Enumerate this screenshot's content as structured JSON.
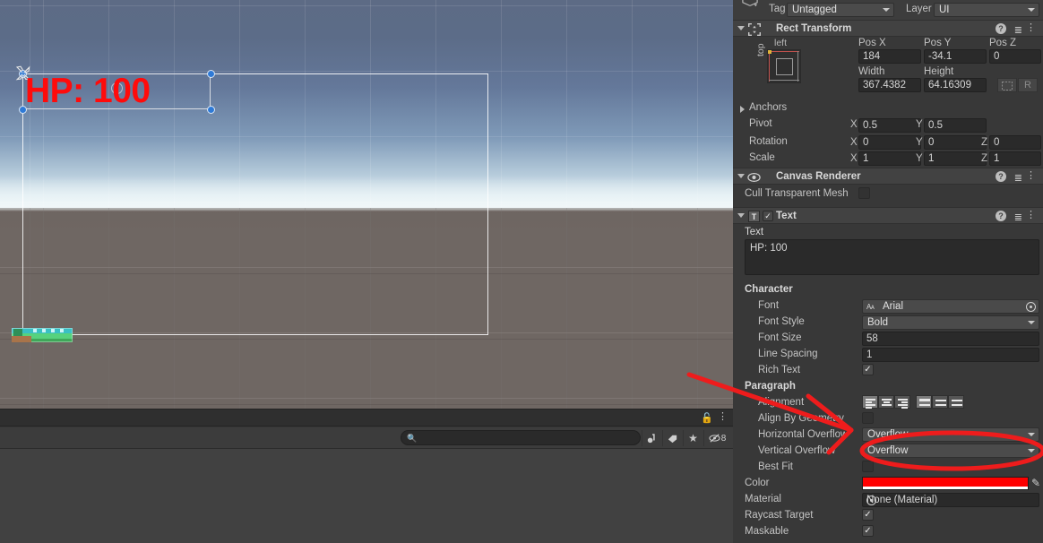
{
  "scene": {
    "overlay_text": "HP: 100",
    "overlay_color": "#ff0b0b",
    "sky_top_color": "#5d6b85",
    "ground_color": "#6f6763"
  },
  "bottom_panel": {
    "search_placeholder": "",
    "search_value": "",
    "search_icon": "search-icon",
    "lock_icon": "lock-icon",
    "kebab_icon": "kebab-menu-icon",
    "tools": [
      {
        "icon": "audio-listener-icon",
        "label": ""
      },
      {
        "icon": "tag-icon",
        "label": ""
      },
      {
        "icon": "star-icon",
        "label": ""
      },
      {
        "icon": "hidden-objects-icon",
        "label": "8"
      }
    ]
  },
  "inspector": {
    "tag_label": "Tag",
    "tag_value": "Untagged",
    "layer_label": "Layer",
    "layer_value": "UI",
    "components": [
      {
        "name": "Rect Transform",
        "icon": "rect-transform-icon",
        "anchor_preset_label_h": "left",
        "anchor_preset_label_v": "top",
        "col_headers": [
          "Pos X",
          "Pos Y",
          "Pos Z"
        ],
        "pos": [
          "184",
          "-34.1",
          "0"
        ],
        "size_headers": [
          "Width",
          "Height"
        ],
        "size": [
          "367.4382",
          "64.16309"
        ],
        "blueprint_btn": "",
        "raw_btn": "R",
        "anchors_label": "Anchors",
        "pivot_label": "Pivot",
        "pivot": [
          "0.5",
          "0.5"
        ],
        "rotation_label": "Rotation",
        "rotation": [
          "0",
          "0",
          "0"
        ],
        "scale_label": "Scale",
        "scale": [
          "1",
          "1",
          "1"
        ],
        "axes": [
          "X",
          "Y",
          "Z"
        ]
      },
      {
        "name": "Canvas Renderer",
        "icon": "canvas-renderer-icon",
        "cull_label": "Cull Transparent Mesh",
        "cull_checked": false
      },
      {
        "name": "Text",
        "icon": "text-component-icon",
        "enabled": true,
        "text_label": "Text",
        "text_value": "HP: 100",
        "character_section": "Character",
        "font_label": "Font",
        "font_value": "Arial",
        "font_style_label": "Font Style",
        "font_style_value": "Bold",
        "font_size_label": "Font Size",
        "font_size_value": "58",
        "line_spacing_label": "Line Spacing",
        "line_spacing_value": "1",
        "rich_text_label": "Rich Text",
        "rich_text_checked": true,
        "paragraph_section": "Paragraph",
        "alignment_label": "Alignment",
        "align_by_geometry_label": "Align By Geometry",
        "align_by_geometry_checked": false,
        "horizontal_overflow_label": "Horizontal Overflow",
        "horizontal_overflow_value": "Overflow",
        "vertical_overflow_label": "Vertical Overflow",
        "vertical_overflow_value": "Overflow",
        "best_fit_label": "Best Fit",
        "best_fit_checked": false,
        "color_label": "Color",
        "color_value": "#ff0000",
        "material_label": "Material",
        "material_value": "None (Material)",
        "raycast_target_label": "Raycast Target",
        "raycast_target_checked": true,
        "maskable_label": "Maskable",
        "maskable_checked": true
      }
    ]
  },
  "annotations": {
    "arrow_color": "#ee1c1c",
    "highlight_color": "#ee1c1c",
    "arrow_name": "red-annotation-arrow",
    "ellipse_name": "red-annotation-ellipse"
  }
}
